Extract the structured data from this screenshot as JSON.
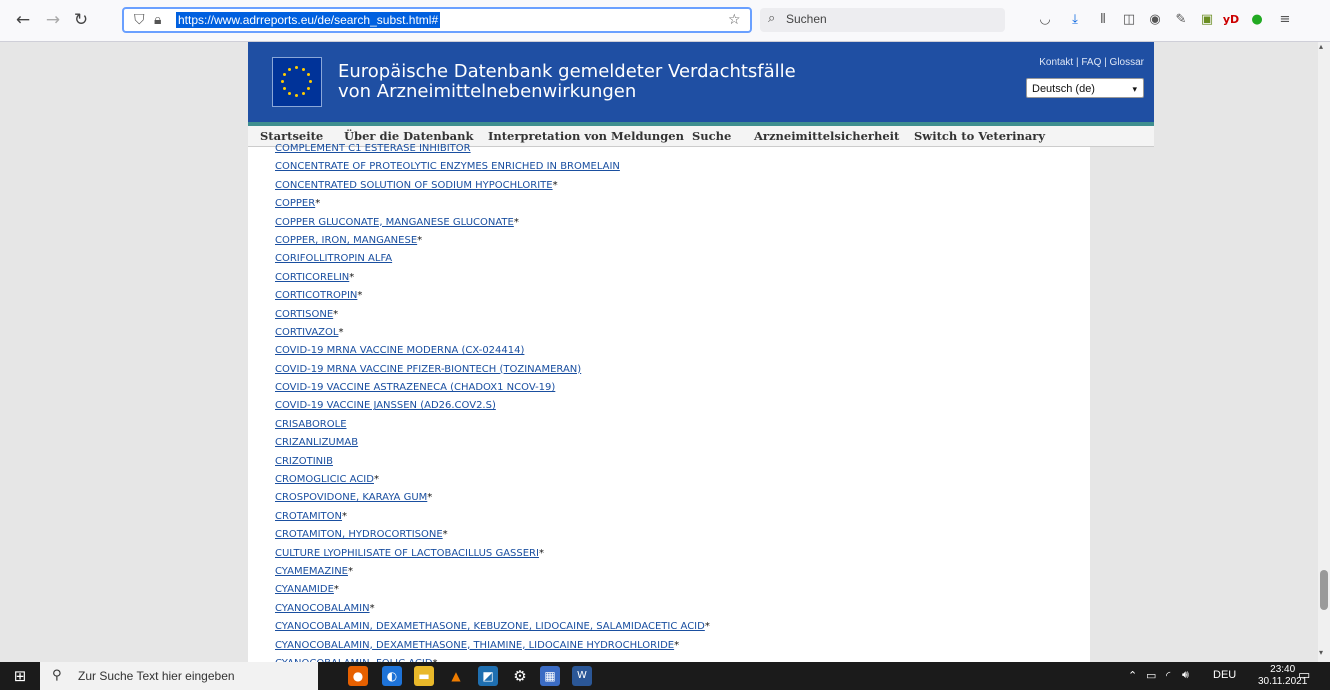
{
  "browser": {
    "url": "https://www.adrreports.eu/de/search_subst.html#",
    "search_placeholder": "Suchen"
  },
  "header": {
    "title_line1": "Europäische Datenbank gemeldeter Verdachtsfälle",
    "title_line2": "von Arzneimittelnebenwirkungen",
    "links": [
      "Kontakt",
      "FAQ",
      "Glossar"
    ],
    "link_sep": "|",
    "language": "Deutsch (de)"
  },
  "nav": {
    "items": [
      "Startseite",
      "Über die Datenbank",
      "Interpretation von Meldungen",
      "Suche",
      "Arzneimittelsicherheit",
      "Switch to Veterinary"
    ]
  },
  "substances": [
    {
      "name": "COMPLEMENT C1 ESTERASE INHIBITOR",
      "star": ""
    },
    {
      "name": "CONCENTRATE OF PROTEOLYTIC ENZYMES ENRICHED IN BROMELAIN",
      "star": ""
    },
    {
      "name": "CONCENTRATED SOLUTION OF SODIUM HYPOCHLORITE",
      "star": "*"
    },
    {
      "name": "COPPER",
      "star": "*"
    },
    {
      "name": "COPPER GLUCONATE, MANGANESE GLUCONATE",
      "star": "*"
    },
    {
      "name": "COPPER, IRON, MANGANESE",
      "star": "*"
    },
    {
      "name": "CORIFOLLITROPIN ALFA",
      "star": ""
    },
    {
      "name": "CORTICORELIN",
      "star": "*"
    },
    {
      "name": "CORTICOTROPIN",
      "star": "*"
    },
    {
      "name": "CORTISONE",
      "star": "*"
    },
    {
      "name": "CORTIVAZOL",
      "star": "*"
    },
    {
      "name": "COVID-19 MRNA VACCINE MODERNA (CX-024414)",
      "star": ""
    },
    {
      "name": "COVID-19 MRNA VACCINE PFIZER-BIONTECH (TOZINAMERAN)",
      "star": ""
    },
    {
      "name": "COVID-19 VACCINE ASTRAZENECA (CHADOX1 NCOV-19)",
      "star": ""
    },
    {
      "name": "COVID-19 VACCINE JANSSEN (AD26.COV2.S)",
      "star": ""
    },
    {
      "name": "CRISABOROLE",
      "star": ""
    },
    {
      "name": "CRIZANLIZUMAB",
      "star": ""
    },
    {
      "name": "CRIZOTINIB",
      "star": ""
    },
    {
      "name": "CROMOGLICIC ACID",
      "star": "*"
    },
    {
      "name": "CROSPOVIDONE, KARAYA GUM",
      "star": "*"
    },
    {
      "name": "CROTAMITON",
      "star": "*"
    },
    {
      "name": "CROTAMITON, HYDROCORTISONE",
      "star": "*"
    },
    {
      "name": "CULTURE LYOPHILISATE OF LACTOBACILLUS GASSERI",
      "star": "*"
    },
    {
      "name": "CYAMEMAZINE",
      "star": "*"
    },
    {
      "name": "CYANAMIDE",
      "star": "*"
    },
    {
      "name": "CYANOCOBALAMIN",
      "star": "*"
    },
    {
      "name": "CYANOCOBALAMIN, DEXAMETHASONE, KEBUZONE, LIDOCAINE, SALAMIDACETIC ACID",
      "star": "*"
    },
    {
      "name": "CYANOCOBALAMIN, DEXAMETHASONE, THIAMINE, LIDOCAINE HYDROCHLORIDE",
      "star": "*"
    },
    {
      "name": "CYANOCOBALAMIN, FOLIC ACID",
      "star": "*"
    }
  ],
  "taskbar": {
    "search_placeholder": "Zur Suche Text hier eingeben",
    "language": "DEU",
    "time": "23:40",
    "date": "30.11.2021"
  },
  "colors": {
    "header_blue": "#1f4fa3",
    "link_blue": "#1a4fa0",
    "accent_teal": "#3f8f8f"
  }
}
